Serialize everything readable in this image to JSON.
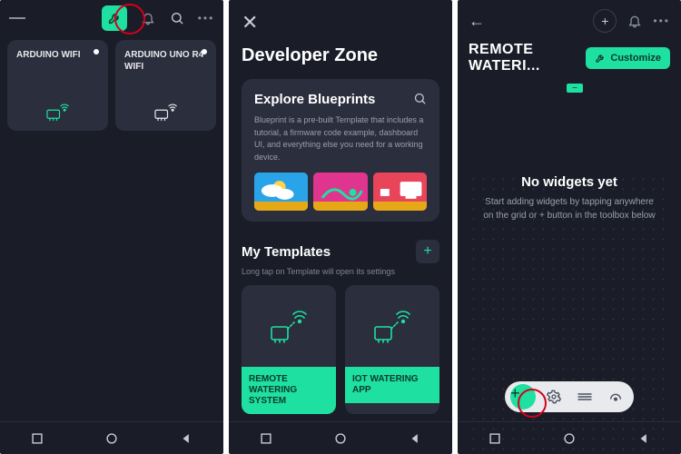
{
  "colors": {
    "accent": "#1ee0a0",
    "bg": "#1a1d28",
    "panel": "#2a2e3d",
    "highlight_red": "#d4001a"
  },
  "screen1": {
    "devices": [
      {
        "title": "ARDUINO WIFI"
      },
      {
        "title": "ARDUINO UNO R4 WIFI"
      }
    ]
  },
  "screen2": {
    "title": "Developer Zone",
    "blueprints": {
      "title": "Explore Blueprints",
      "description": "Blueprint is a pre-built Template that includes a tutorial, a firmware code example, dashboard UI, and everything else you need for a working device.",
      "thumbs": [
        {
          "bg": "#2aa4e8"
        },
        {
          "bg": "#e0358e"
        },
        {
          "bg": "#e8455b"
        }
      ]
    },
    "my_templates_title": "My Templates",
    "hint": "Long tap on Template will open its settings",
    "templates": [
      {
        "name": "REMOTE WATERING SYSTEM"
      },
      {
        "name": "IOT WATERING APP"
      }
    ]
  },
  "screen3": {
    "title": "REMOTE WATERI...",
    "customize_label": "Customize",
    "empty_title": "No widgets yet",
    "empty_sub": "Start adding widgets by tapping anywhere on the grid or + button in the toolbox below"
  }
}
